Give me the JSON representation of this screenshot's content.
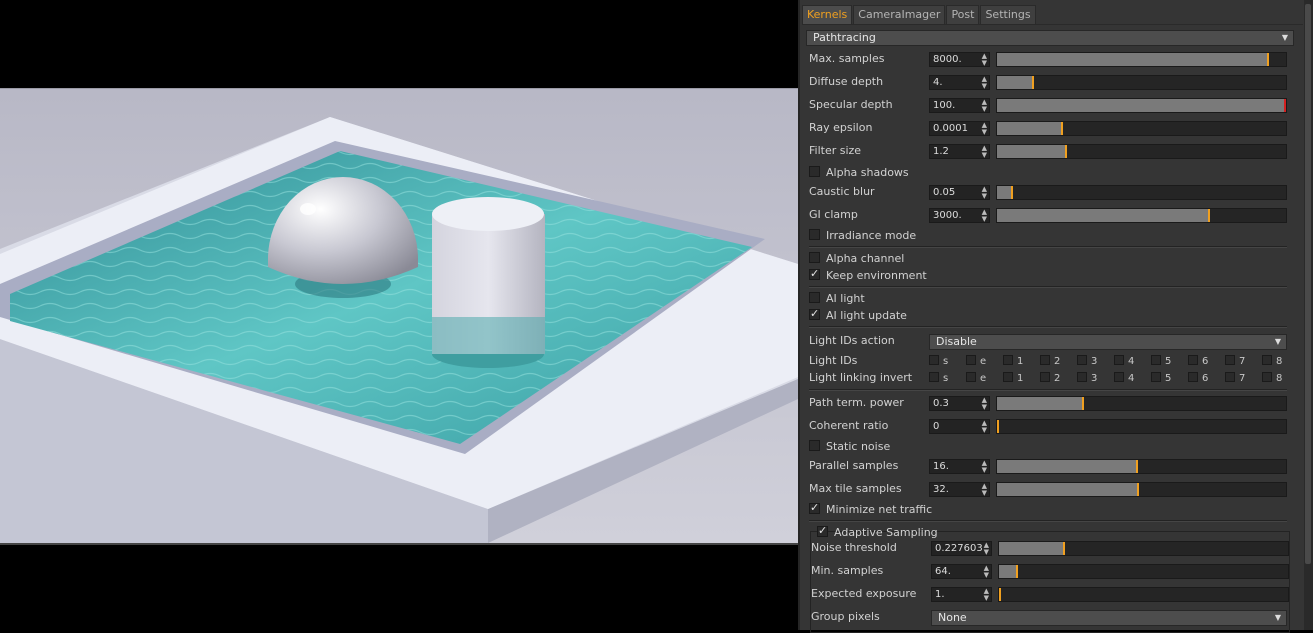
{
  "tabs": [
    "Kernels",
    "CameraImager",
    "Post",
    "Settings"
  ],
  "kernel_type": "Pathtracing",
  "params": [
    {
      "label": "Max. samples",
      "value": "8000.",
      "level": 0.935
    },
    {
      "label": "Diffuse depth",
      "value": "4.",
      "level": 0.12
    },
    {
      "label": "Specular depth",
      "value": "100.",
      "level": 1.0
    },
    {
      "label": "Ray epsilon",
      "value": "0.0001",
      "level": 0.22
    },
    {
      "label": "Filter size",
      "value": "1.2",
      "level": 0.235
    }
  ],
  "alpha_shadows": {
    "label": "Alpha shadows",
    "checked": false
  },
  "params2": [
    {
      "label": "Caustic blur",
      "value": "0.05",
      "level": 0.05
    },
    {
      "label": "GI clamp",
      "value": "3000.",
      "level": 0.73
    }
  ],
  "irradiance_mode": {
    "label": "Irradiance mode",
    "checked": false
  },
  "alpha_channel": {
    "label": "Alpha channel",
    "checked": false
  },
  "keep_environment": {
    "label": "Keep environment",
    "checked": true
  },
  "ai_light": {
    "label": "AI light",
    "checked": false
  },
  "ai_light_update": {
    "label": "AI light update",
    "checked": true
  },
  "light_ids_action": {
    "label": "Light IDs action",
    "value": "Disable"
  },
  "light_ids": {
    "label": "Light IDs",
    "items": [
      "s",
      "e",
      "1",
      "2",
      "3",
      "4",
      "5",
      "6",
      "7",
      "8"
    ]
  },
  "light_linking_invert": {
    "label": "Light linking invert",
    "items": [
      "s",
      "e",
      "1",
      "2",
      "3",
      "4",
      "5",
      "6",
      "7",
      "8"
    ]
  },
  "params3": [
    {
      "label": "Path term. power",
      "value": "0.3",
      "level": 0.295
    },
    {
      "label": "Coherent ratio",
      "value": "0",
      "level": 0.0
    }
  ],
  "static_noise": {
    "label": "Static noise",
    "checked": false
  },
  "params4": [
    {
      "label": "Parallel samples",
      "value": "16.",
      "level": 0.48
    },
    {
      "label": "Max tile samples",
      "value": "32.",
      "level": 0.485
    }
  ],
  "minimize_net_traffic": {
    "label": "Minimize net traffic",
    "checked": true
  },
  "adaptive_sampling": {
    "label": "Adaptive Sampling",
    "checked": true
  },
  "adaptive_params": [
    {
      "label": "Noise threshold",
      "value": "0.227603",
      "level": 0.22
    },
    {
      "label": "Min. samples",
      "value": "64.",
      "level": 0.06
    },
    {
      "label": "Expected exposure",
      "value": "1.",
      "level": 0.0
    }
  ],
  "group_pixels": {
    "label": "Group pixels",
    "value": "None"
  },
  "colors": {
    "accent": "#f0a020",
    "panel": "#353535",
    "water": "#4fb3b5",
    "pool_wall": "#e4e6f0"
  }
}
